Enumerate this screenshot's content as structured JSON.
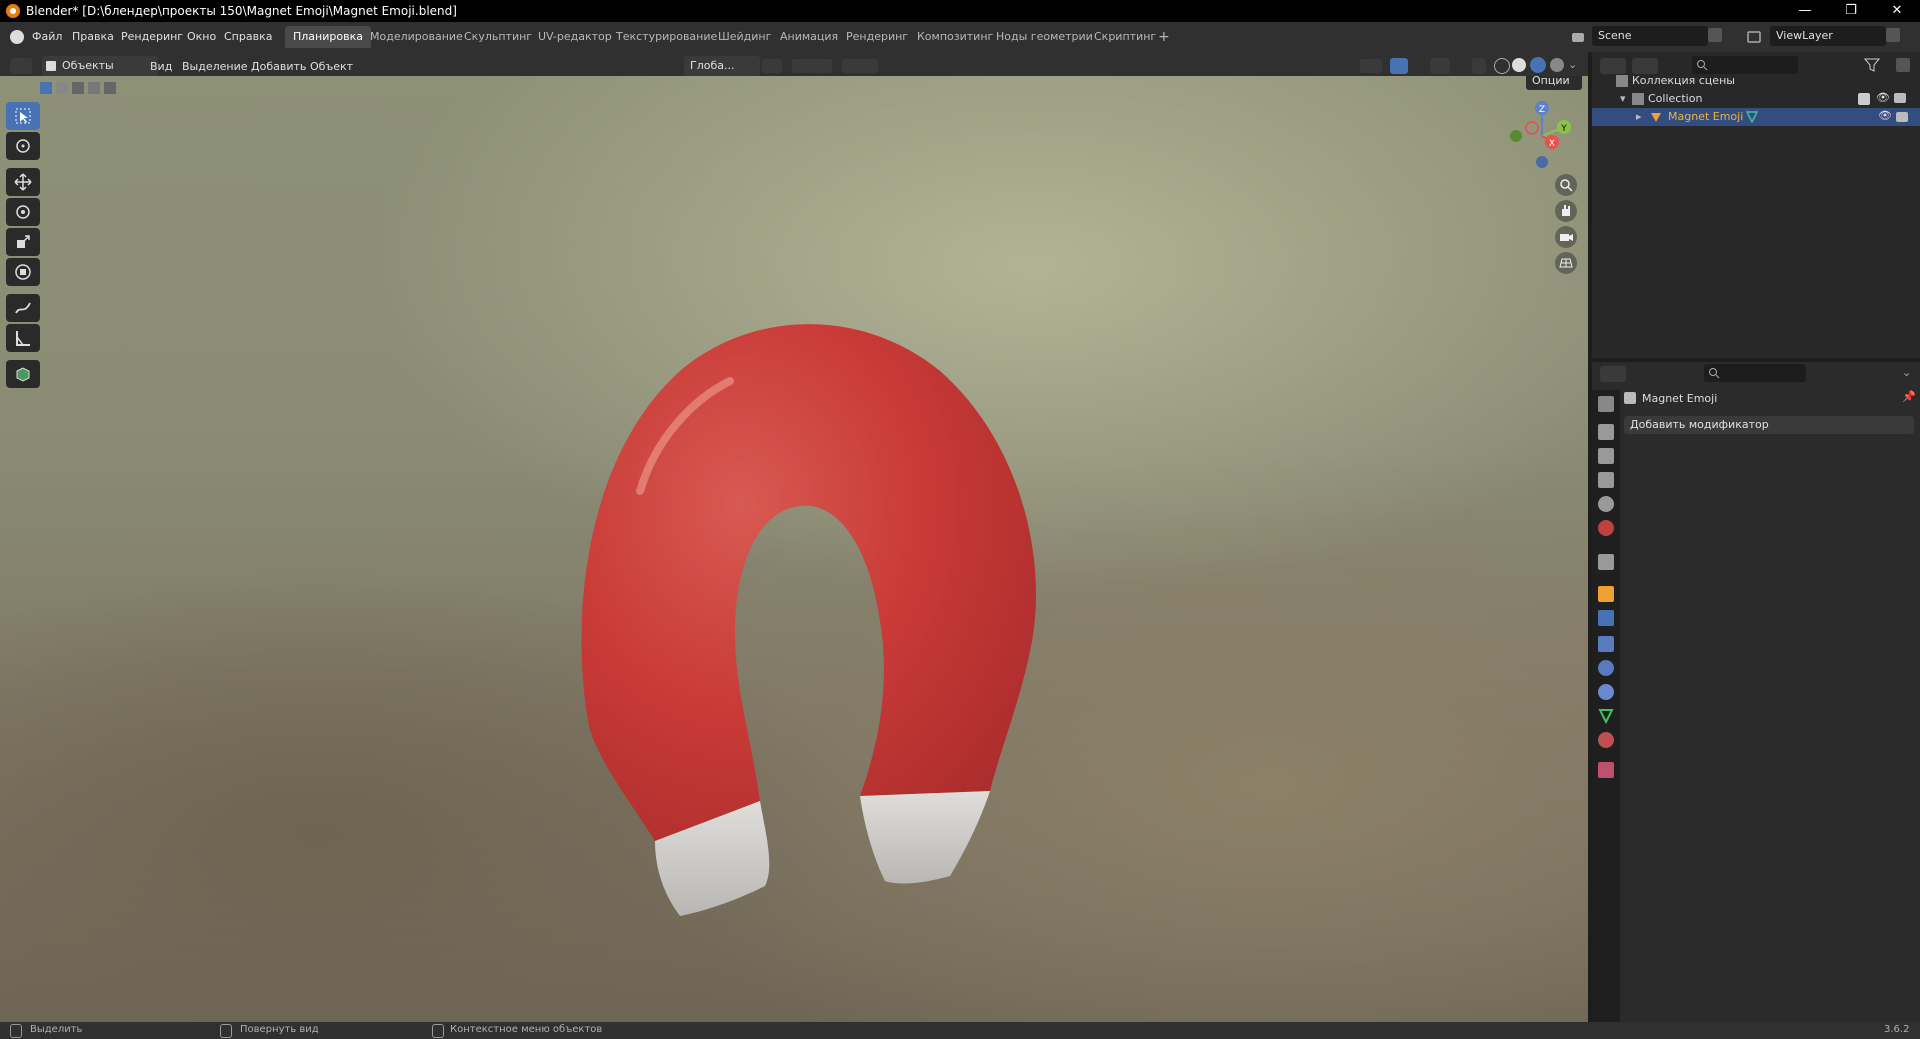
{
  "window": {
    "title": "Blender* [D:\\блендер\\проекты 150\\Magnet Emoji\\Magnet Emoji.blend]",
    "minimize": "—",
    "maximize": "❐",
    "close": "✕"
  },
  "menu": {
    "items": [
      "Файл",
      "Правка",
      "Рендеринг",
      "Окно",
      "Справка"
    ]
  },
  "workspaces": {
    "tabs": [
      "Планировка",
      "Моделирование",
      "Скульптинг",
      "UV-редактор",
      "Текстурирование",
      "Шейдинг",
      "Анимация",
      "Рендеринг",
      "Композитинг",
      "Ноды геометрии",
      "Скриптинг"
    ],
    "add": "+"
  },
  "scene": {
    "name": "Scene",
    "view_layer": "ViewLayer"
  },
  "viewport_header": {
    "mode": "Объекты",
    "menus": [
      "Вид",
      "Выделение",
      "Добавить",
      "Объект"
    ],
    "orientation": "Глоба...",
    "options": "Опции"
  },
  "outliner": {
    "scene_collection": "Коллекция сцены",
    "collection": "Collection",
    "object": "Magnet Emoji"
  },
  "properties": {
    "object_name": "Magnet Emoji",
    "add_modifier": "Добавить модификатор"
  },
  "status": {
    "select": "Выделить",
    "rotate": "Повернуть вид",
    "context": "Контекстное меню объектов",
    "version": "3.6.2"
  },
  "gizmo": {
    "x": "X",
    "y": "Y",
    "z": "Z"
  },
  "colors": {
    "magnet_red": "#c93a37",
    "magnet_tip": "#d6d4d0",
    "accent": "#4772b3",
    "object_orange": "#f0a030"
  }
}
